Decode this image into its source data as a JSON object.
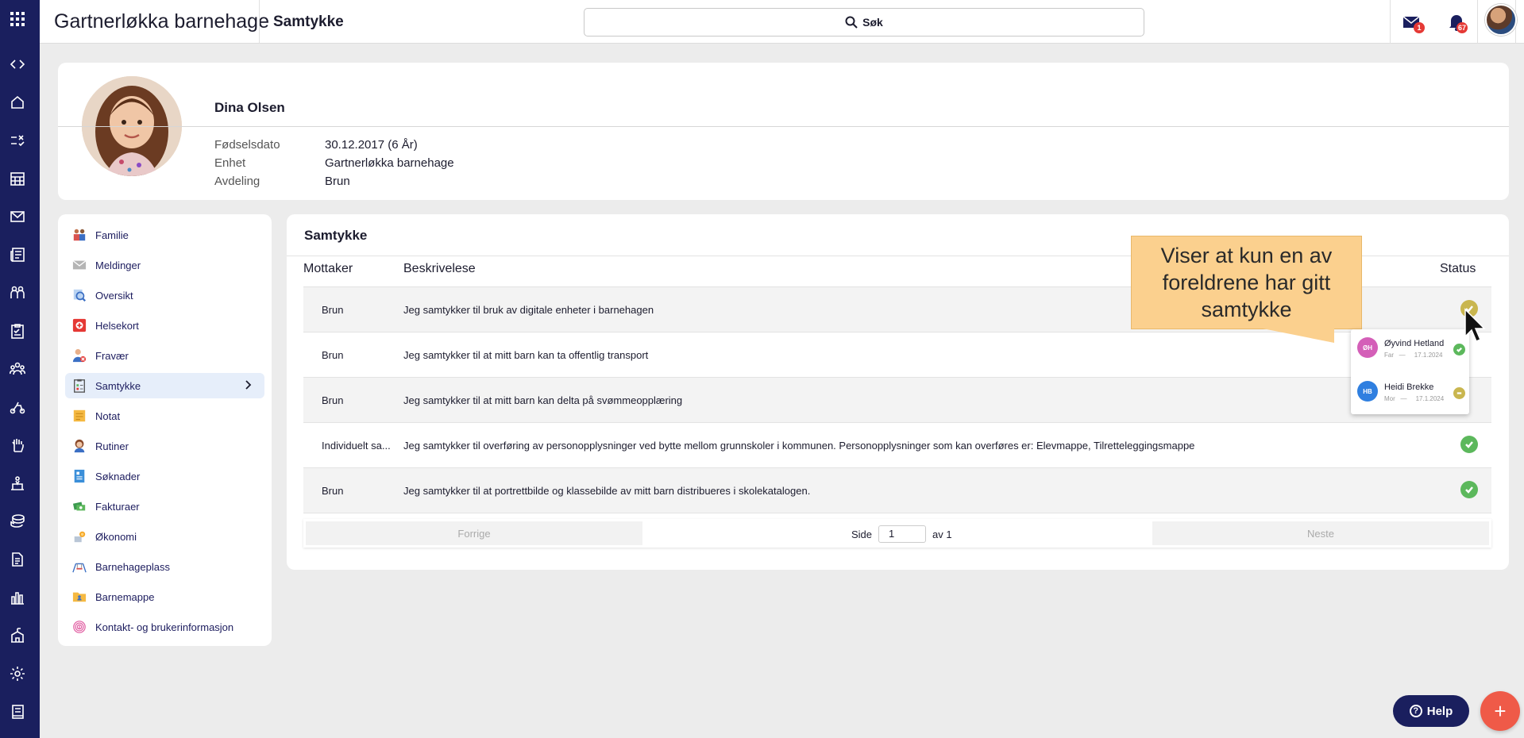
{
  "topbar": {
    "app_title": "Gartnerløkka barnehage",
    "page_title": "Samtykke",
    "search_label": "Søk",
    "mail_badge": "1",
    "notif_badge": "67"
  },
  "rail_icons": [
    "apps-grid-icon",
    "code-toggle-icon",
    "home-icon",
    "tasks-icon",
    "calendar-icon",
    "mail-icon",
    "news-icon",
    "children-icon",
    "checklist-icon",
    "groups-icon",
    "activity-icon",
    "hand-icon",
    "bed-icon",
    "coins-icon",
    "document-icon",
    "chart-icon",
    "school-icon",
    "settings-icon",
    "book-icon"
  ],
  "profile": {
    "name": "Dina Olsen",
    "fields": [
      {
        "label": "Fødselsdato",
        "value": "30.12.2017 (6 År)"
      },
      {
        "label": "Enhet",
        "value": "Gartnerløkka barnehage"
      },
      {
        "label": "Avdeling",
        "value": "Brun"
      }
    ]
  },
  "menu": {
    "items": [
      {
        "label": "Familie",
        "icon": "family-icon",
        "color": "#d9534f"
      },
      {
        "label": "Meldinger",
        "icon": "envelope-icon",
        "color": "#8a8a8a"
      },
      {
        "label": "Oversikt",
        "icon": "overview-icon",
        "color": "#3b6fc4"
      },
      {
        "label": "Helsekort",
        "icon": "health-card-icon",
        "color": "#e53935"
      },
      {
        "label": "Fravær",
        "icon": "absence-icon",
        "color": "#d9534f"
      },
      {
        "label": "Samtykke",
        "icon": "consent-icon",
        "color": "#555"
      },
      {
        "label": "Notat",
        "icon": "note-icon",
        "color": "#f5b942"
      },
      {
        "label": "Rutiner",
        "icon": "routines-icon",
        "color": "#c0704a"
      },
      {
        "label": "Søknader",
        "icon": "application-icon",
        "color": "#3b8fd9"
      },
      {
        "label": "Fakturaer",
        "icon": "invoice-icon",
        "color": "#3c9a4f"
      },
      {
        "label": "Økonomi",
        "icon": "economy-icon",
        "color": "#f5a623"
      },
      {
        "label": "Barnehageplass",
        "icon": "kindergarten-place-icon",
        "color": "#d94f4f"
      },
      {
        "label": "Barnemappe",
        "icon": "folder-icon",
        "color": "#f5b942"
      },
      {
        "label": "Kontakt- og brukerinformasjon",
        "icon": "fingerprint-icon",
        "color": "#e05aa0"
      }
    ],
    "active_index": 5
  },
  "consent": {
    "title": "Samtykke",
    "columns": {
      "recipient": "Mottaker",
      "description": "Beskrivelese",
      "status": "Status"
    },
    "rows": [
      {
        "recipient": "Brun",
        "description": "Jeg samtykker til bruk av digitale enheter i barnehagen",
        "status": "partial"
      },
      {
        "recipient": "Brun",
        "description": "Jeg samtykker til at mitt barn kan ta offentlig transport",
        "status": "approved"
      },
      {
        "recipient": "Brun",
        "description": "Jeg samtykker til at mitt barn kan delta på svømmeopplæring",
        "status": "approved"
      },
      {
        "recipient": "Individuelt sa...",
        "description": "Jeg samtykker til overføring av personopplysninger ved bytte mellom grunnskoler i kommunen. Personopplysninger som kan overføres er: Elevmappe, Tilretteleggingsmappe",
        "status": "approved"
      },
      {
        "recipient": "Brun",
        "description": "Jeg samtykker til at portrettbilde og klassebilde av mitt barn distribueres i skolekatalogen.",
        "status": "approved"
      }
    ],
    "pager": {
      "prev": "Forrige",
      "page_label": "Side",
      "page": "1",
      "of_label": "av 1",
      "next": "Neste"
    }
  },
  "callout": {
    "text": "Viser at kun en av foreldrene har gitt samtykke"
  },
  "popup": {
    "people": [
      {
        "initials": "ØH",
        "name": "Øyvind Hetland",
        "role": "Far",
        "sep": "—",
        "date": "17.1.2024",
        "status": "approved",
        "color": "#d45fb8"
      },
      {
        "initials": "HB",
        "name": "Heidi Brekke",
        "role": "Mor",
        "sep": "—",
        "date": "17.1.2024",
        "status": "pending",
        "color": "#2f7fe0"
      }
    ]
  },
  "help": {
    "label": "Help"
  },
  "colors": {
    "rail": "#1a1f5e",
    "approved": "#5cb85c",
    "partial": "#c9b64f",
    "fab": "#ef5a48",
    "callout": "#fbd08e"
  }
}
